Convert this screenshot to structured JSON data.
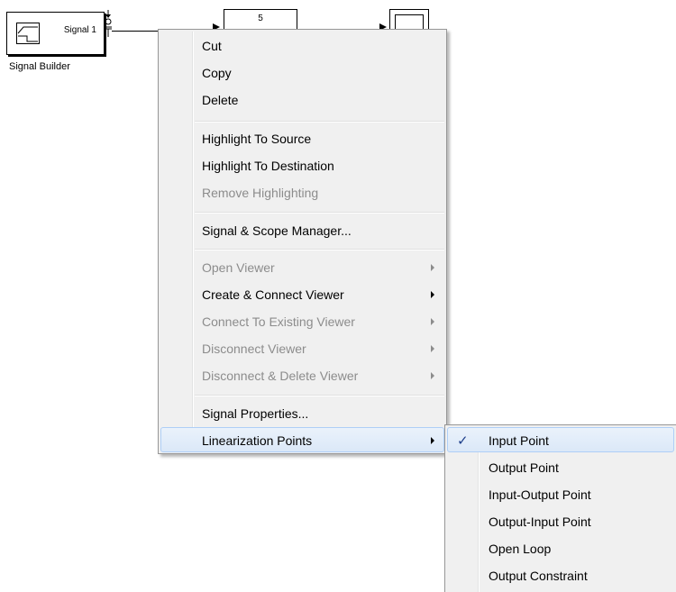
{
  "diagram": {
    "signal_builder": {
      "port_label": "Signal 1",
      "caption": "Signal Builder"
    },
    "gain": {
      "value": "5"
    }
  },
  "context_menu": {
    "items": [
      {
        "label": "Cut",
        "enabled": true
      },
      {
        "label": "Copy",
        "enabled": true
      },
      {
        "label": "Delete",
        "enabled": true
      },
      {
        "label": "Highlight To Source",
        "enabled": true
      },
      {
        "label": "Highlight To Destination",
        "enabled": true
      },
      {
        "label": "Remove Highlighting",
        "enabled": false
      },
      {
        "label": "Signal & Scope Manager...",
        "enabled": true
      },
      {
        "label": "Open Viewer",
        "enabled": false,
        "submenu": true
      },
      {
        "label": "Create & Connect Viewer",
        "enabled": true,
        "submenu": true
      },
      {
        "label": "Connect To Existing Viewer",
        "enabled": false,
        "submenu": true
      },
      {
        "label": "Disconnect Viewer",
        "enabled": false,
        "submenu": true
      },
      {
        "label": "Disconnect & Delete Viewer",
        "enabled": false,
        "submenu": true
      },
      {
        "label": "Signal Properties...",
        "enabled": true
      },
      {
        "label": "Linearization Points",
        "enabled": true,
        "submenu": true,
        "highlighted": true
      }
    ]
  },
  "linearization_submenu": {
    "items": [
      {
        "label": "Input Point",
        "checked": true,
        "check_mark": "✓"
      },
      {
        "label": "Output Point",
        "checked": false
      },
      {
        "label": "Input-Output Point",
        "checked": false
      },
      {
        "label": "Output-Input Point",
        "checked": false
      },
      {
        "label": "Open Loop",
        "checked": false
      },
      {
        "label": "Output Constraint",
        "checked": false
      }
    ]
  },
  "colors": {
    "menu_background": "#f0f0f0",
    "menu_border": "#979797",
    "disabled_text": "#8c8c8c",
    "hover_border": "#aecff7",
    "check_mark": "#1e3f8a"
  }
}
